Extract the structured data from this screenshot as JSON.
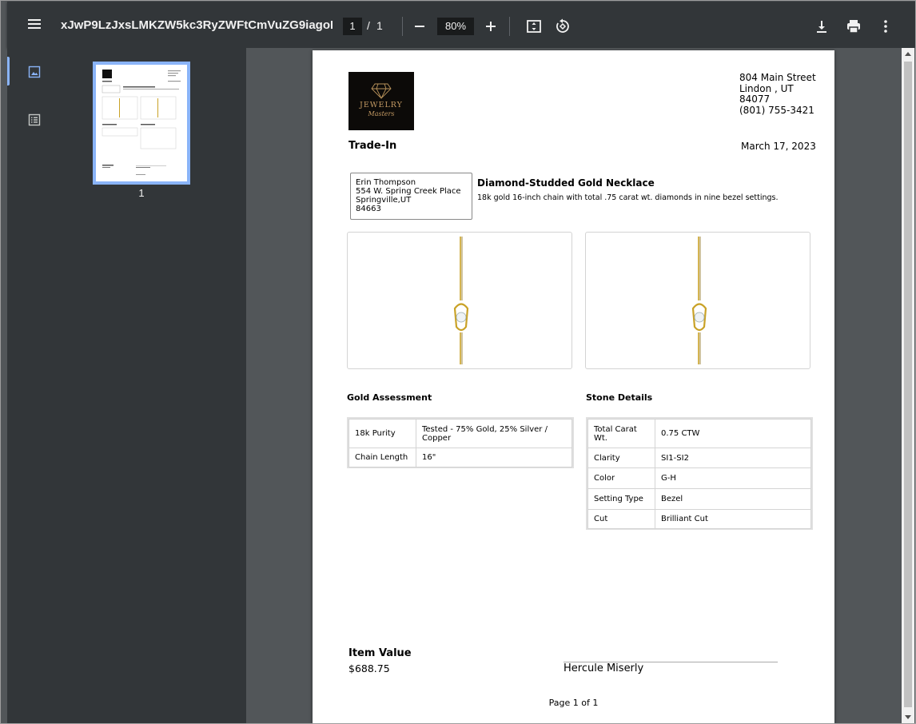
{
  "toolbar": {
    "title": "xJwP9LzJxsLMKZW5kc3RyZWFtCmVuZG9iagoKMj...",
    "current_page": "1",
    "page_separator": "/",
    "total_pages": "1",
    "zoom": "80%"
  },
  "sidebar": {
    "thumbnail_label": "1"
  },
  "document": {
    "logo_text_top": "JEWELRY",
    "logo_text_bottom": "Masters",
    "address": {
      "street": "804 Main Street",
      "city_state": "Lindon , UT",
      "zip": "84077",
      "phone": "(801) 755-3421"
    },
    "title": "Trade-In",
    "date": "March 17, 2023",
    "customer": {
      "name": "Erin Thompson",
      "street": "554 W. Spring Creek Place",
      "city_state": "Springville,UT",
      "zip": "84663"
    },
    "item_name": "Diamond-Studded Gold Necklace",
    "item_description": "18k gold 16-inch chain with total .75 carat wt. diamonds in nine bezel settings.",
    "gold_assessment": {
      "title": "Gold Assessment",
      "rows": [
        {
          "label": "18k Purity",
          "value": "Tested - 75% Gold, 25% Silver / Copper"
        },
        {
          "label": "Chain Length",
          "value": "16\""
        }
      ]
    },
    "stone_details": {
      "title": "Stone Details",
      "rows": [
        {
          "label": "Total Carat Wt.",
          "value": "0.75 CTW"
        },
        {
          "label": "Clarity",
          "value": "SI1-SI2"
        },
        {
          "label": "Color",
          "value": "G-H"
        },
        {
          "label": "Setting Type",
          "value": "Bezel"
        },
        {
          "label": "Cut",
          "value": "Brilliant Cut"
        }
      ]
    },
    "item_value_label": "Item Value",
    "item_value": "$688.75",
    "signature_name": "Hercule Miserly",
    "footer": "Page 1 of 1"
  },
  "colors": {
    "toolbar_bg": "#323639",
    "viewer_bg": "#525659",
    "accent": "#8ab4f8"
  },
  "icons": [
    "menu-icon",
    "zoom-out-icon",
    "zoom-in-icon",
    "fit-page-icon",
    "rotate-icon",
    "download-icon",
    "print-icon",
    "more-vert-icon",
    "thumbnails-icon",
    "outline-icon"
  ]
}
